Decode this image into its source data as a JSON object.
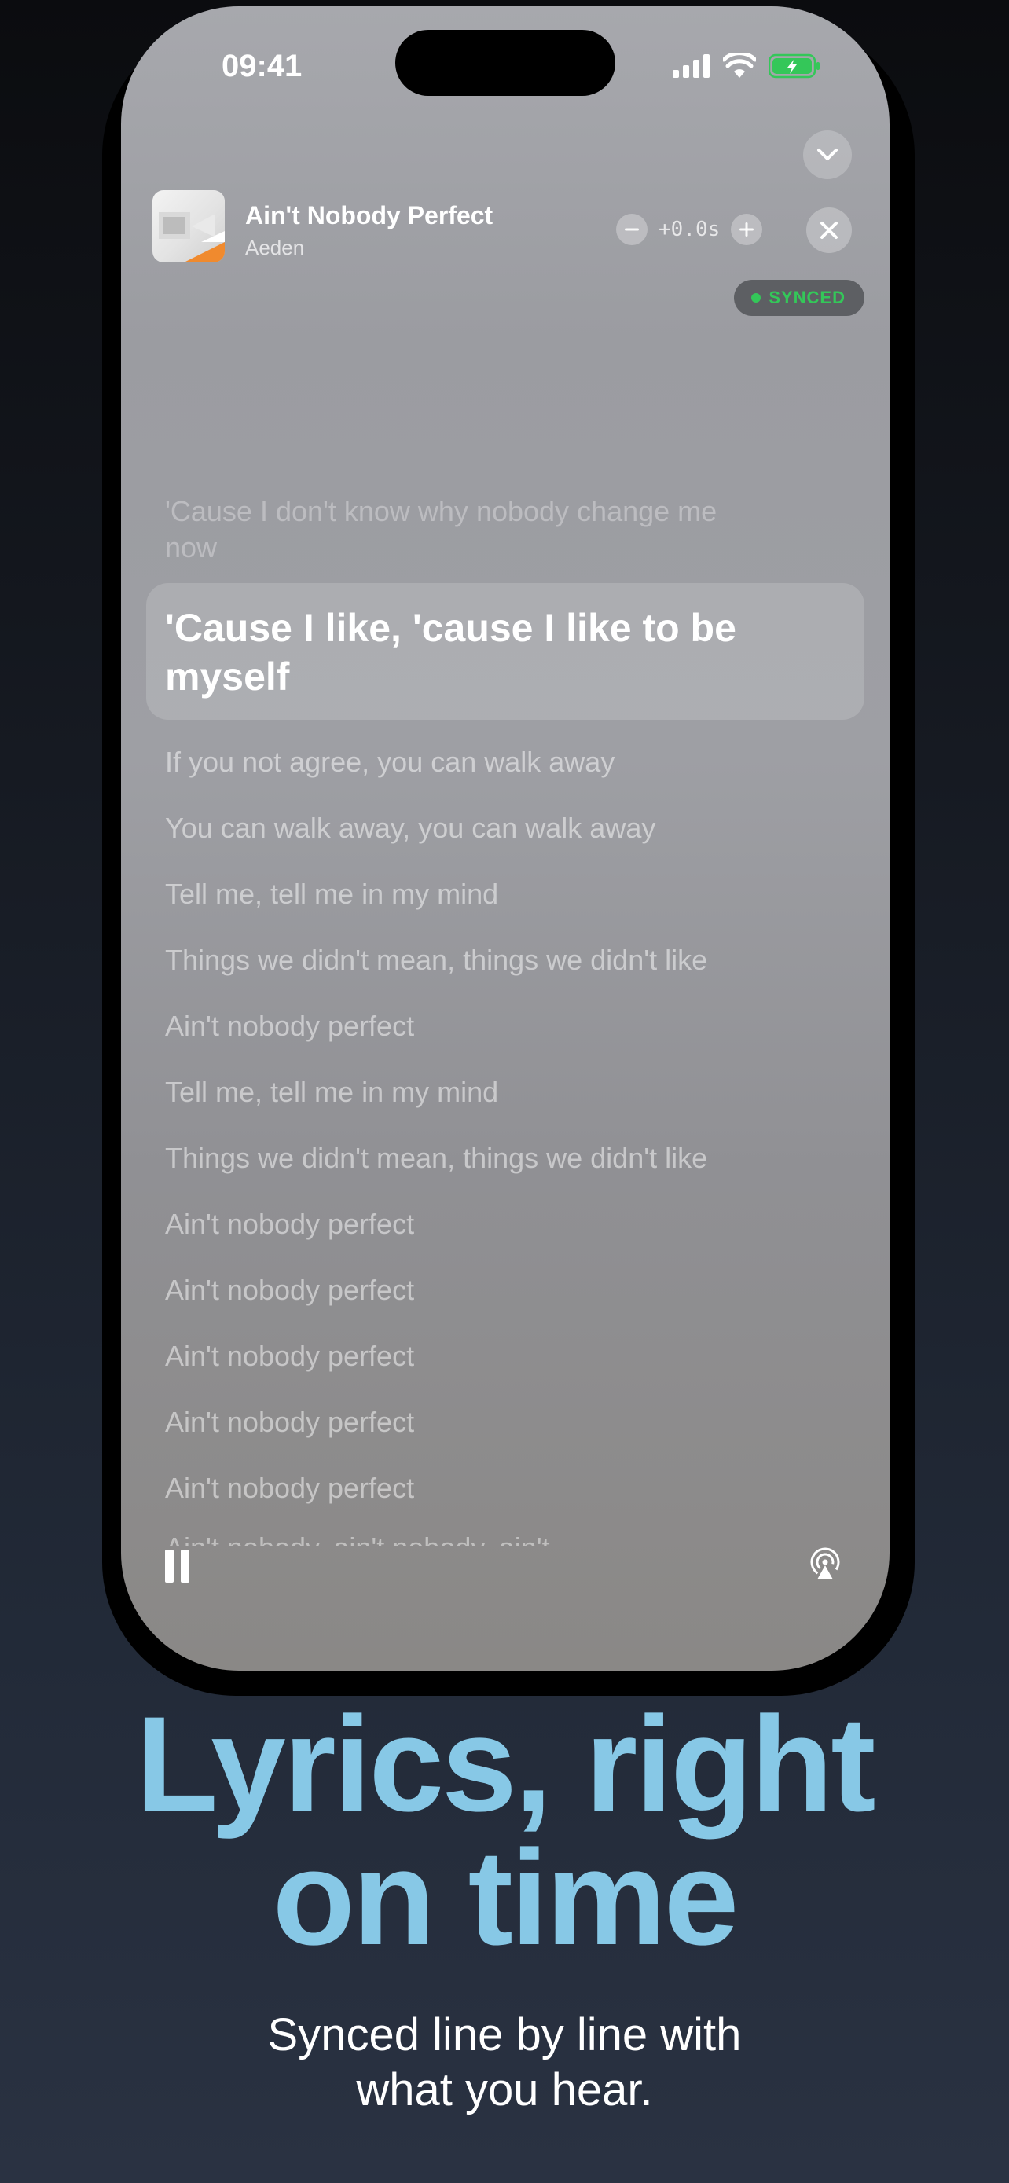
{
  "status_bar": {
    "time": "09:41"
  },
  "now_playing": {
    "title": "Ain't Nobody Perfect",
    "artist": "Aeden",
    "offset": "+0.0s",
    "sync_badge": "SYNCED"
  },
  "lyrics": {
    "previous": "'Cause I don't know why nobody change me now",
    "current": "'Cause I like, 'cause I like to be myself",
    "upcoming": [
      "If you not agree, you can walk away",
      "You can walk away, you can walk away",
      "Tell me, tell me in my mind",
      "Things we didn't mean, things we didn't like",
      "Ain't nobody perfect",
      "Tell me, tell me in my mind",
      "Things we didn't mean, things we didn't like",
      "Ain't nobody perfect",
      "Ain't nobody perfect",
      "Ain't nobody perfect",
      "Ain't nobody perfect",
      "Ain't nobody perfect"
    ],
    "partial": "Ain't nobody, ain't nobody, ain't"
  },
  "marketing": {
    "headline_line1": "Lyrics, right",
    "headline_line2": "on time",
    "subtitle": "Synced line by line with what you hear."
  },
  "colors": {
    "headline": "#87c8e6",
    "synced_green": "#34c759"
  }
}
